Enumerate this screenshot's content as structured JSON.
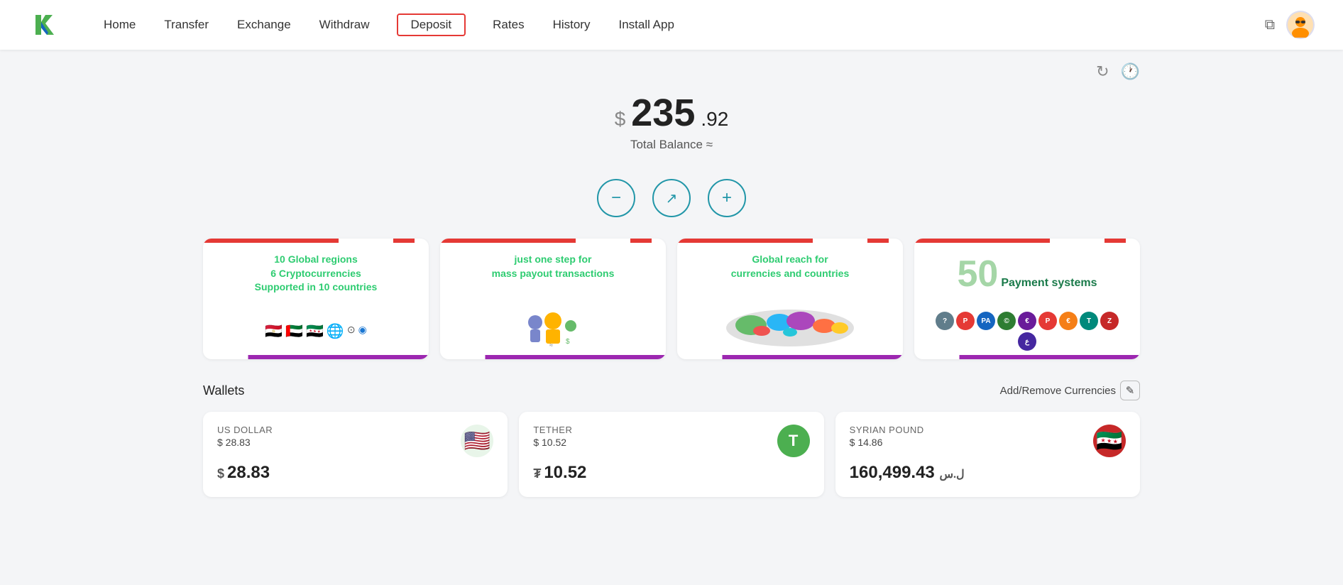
{
  "header": {
    "logo_alt": "K Logo",
    "nav": {
      "home": "Home",
      "transfer": "Transfer",
      "exchange": "Exchange",
      "withdraw": "Withdraw",
      "deposit": "Deposit",
      "rates": "Rates",
      "history": "History",
      "install_app": "Install App"
    }
  },
  "balance": {
    "dollar_sign": "$",
    "main": "235",
    "separator": ".",
    "cents": "92",
    "label": "Total Balance ≈"
  },
  "action_buttons": {
    "withdraw": "−",
    "transfer": "↗",
    "deposit": "+"
  },
  "feature_cards": [
    {
      "id": "global-regions",
      "title": "10 Global regions\n6 Cryptocurrencies\nSupported in 10 countries"
    },
    {
      "id": "mass-payout",
      "title": "just one step for\nmass payout transactions"
    },
    {
      "id": "global-reach",
      "title": "Global reach for\ncurrencies and countries"
    },
    {
      "id": "payment-systems",
      "number": "50",
      "label": "Payment systems"
    }
  ],
  "wallets": {
    "title": "Wallets",
    "add_remove_label": "Add/Remove Currencies",
    "cards": [
      {
        "id": "usd",
        "name": "US DOLLAR",
        "usd_value": "$ 28.83",
        "main_symbol": "$",
        "main_amount": "28.83",
        "flag": "🇺🇸",
        "flag_bg": "#4caf50"
      },
      {
        "id": "tether",
        "name": "TETHER",
        "usd_value": "$ 10.52",
        "main_symbol": "₮",
        "main_amount": "10.52",
        "flag": "T",
        "flag_bg": "#4caf50"
      },
      {
        "id": "syp",
        "name": "SYRIAN POUND",
        "usd_value": "$ 14.86",
        "main_symbol": "ل.س",
        "main_amount": "160,499.43",
        "flag": "🇸🇾",
        "flag_bg": "#c62828"
      }
    ]
  },
  "colors": {
    "accent": "#2196a8",
    "green": "#2ecc71",
    "dark_green": "#1a7a4a",
    "red": "#e53935",
    "purple": "#9c27b0"
  }
}
